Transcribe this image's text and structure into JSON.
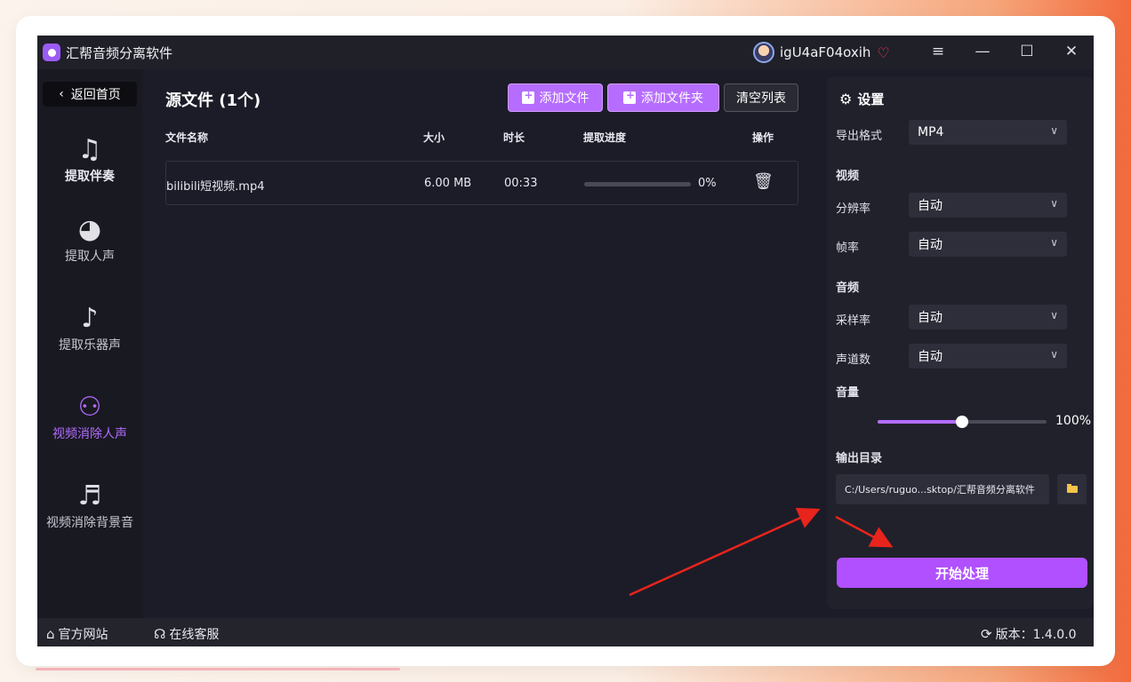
{
  "app": {
    "title": "汇帮音频分离软件"
  },
  "user": {
    "name": "igU4aF04oxih"
  },
  "window_controls": {
    "menu": "≡",
    "minimize": "—",
    "maximize": "☐",
    "close": "✕"
  },
  "sidebar": {
    "back_label": "返回首页",
    "items": [
      {
        "label": "提取伴奏",
        "icon": "music-note-icon"
      },
      {
        "label": "提取人声",
        "icon": "voice-icon"
      },
      {
        "label": "提取乐器声",
        "icon": "guitar-icon"
      },
      {
        "label": "视频消除人声",
        "icon": "user-remove-icon"
      },
      {
        "label": "视频消除背景音",
        "icon": "music-mute-icon"
      }
    ]
  },
  "main": {
    "title": "源文件 (1个)",
    "buttons": {
      "add_file": "添加文件",
      "add_folder": "添加文件夹",
      "clear": "清空列表"
    },
    "columns": {
      "name": "文件名称",
      "size": "大小",
      "duration": "时长",
      "progress": "提取进度",
      "action": "操作"
    },
    "files": [
      {
        "name": "bilibili短视频.mp4",
        "size": "6.00 MB",
        "duration": "00:33",
        "progress_text": "0%",
        "progress": 0
      }
    ]
  },
  "settings": {
    "title": "设置",
    "export_format_label": "导出格式",
    "export_format": "MP4",
    "video_section": "视频",
    "resolution_label": "分辨率",
    "resolution": "自动",
    "framerate_label": "帧率",
    "framerate": "自动",
    "audio_section": "音频",
    "samplerate_label": "采样率",
    "samplerate": "自动",
    "channels_label": "声道数",
    "channels": "自动",
    "volume_label": "音量",
    "volume_text": "100%",
    "volume": 0.5,
    "output_dir_label": "输出目录",
    "output_dir": "C:/Users/ruguo...sktop/汇帮音频分离软件",
    "start_label": "开始处理"
  },
  "statusbar": {
    "website": "官方网站",
    "support": "在线客服",
    "version": "版本：1.4.0.0"
  },
  "colors": {
    "accent": "#b050ff",
    "window_bg": "#1c1c28",
    "panel_bg": "#21212c",
    "annotation_arrow": "#e8241c"
  }
}
